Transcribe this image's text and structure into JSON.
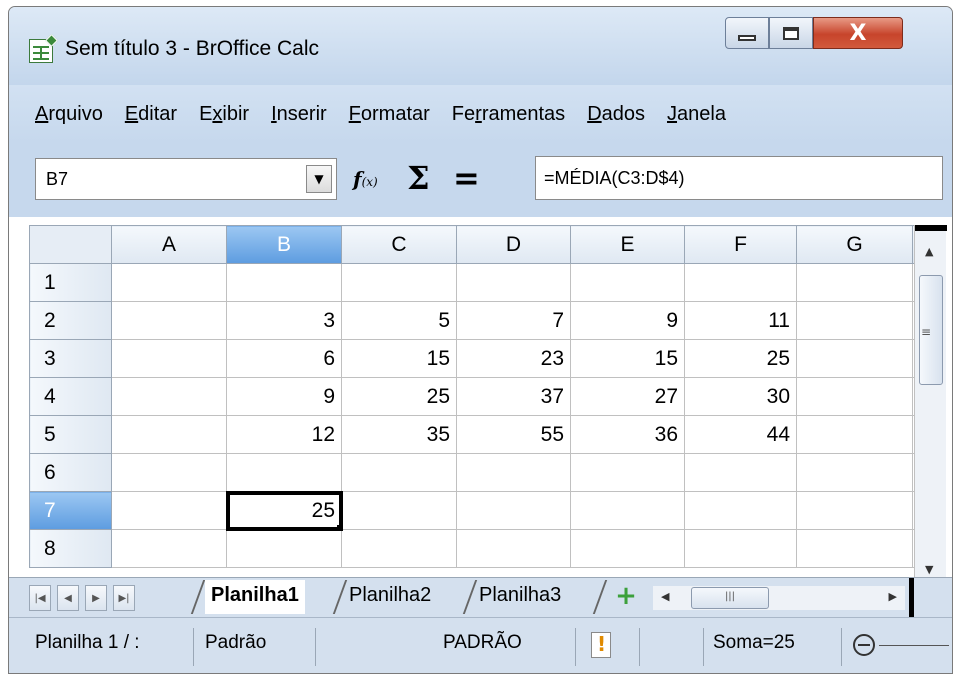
{
  "window": {
    "title": "Sem título 3 - BrOffice Calc",
    "close_glyph": "X"
  },
  "menu": [
    {
      "pre": "",
      "ul": "A",
      "post": "rquivo"
    },
    {
      "pre": "",
      "ul": "E",
      "post": "ditar"
    },
    {
      "pre": "E",
      "ul": "x",
      "post": "ibir"
    },
    {
      "pre": "",
      "ul": "I",
      "post": "nserir"
    },
    {
      "pre": "",
      "ul": "F",
      "post": "ormatar"
    },
    {
      "pre": "Fe",
      "ul": "r",
      "post": "ramentas"
    },
    {
      "pre": "",
      "ul": "D",
      "post": "ados"
    },
    {
      "pre": "",
      "ul": "J",
      "post": "anela"
    }
  ],
  "formula_bar": {
    "name_box": "B7",
    "fx_label": "f",
    "fx_sub": "(x)",
    "sum_symbol": "Σ",
    "equals_symbol": "=",
    "formula": "=MÉDIA(C3:D$4)"
  },
  "sheet": {
    "columns": [
      "A",
      "B",
      "C",
      "D",
      "E",
      "F",
      "G"
    ],
    "active_column": "B",
    "active_row": "7",
    "rows": [
      {
        "label": "1",
        "cells": [
          "",
          "",
          "",
          "",
          "",
          "",
          ""
        ]
      },
      {
        "label": "2",
        "cells": [
          "",
          "3",
          "5",
          "7",
          "9",
          "11",
          ""
        ]
      },
      {
        "label": "3",
        "cells": [
          "",
          "6",
          "15",
          "23",
          "15",
          "25",
          ""
        ]
      },
      {
        "label": "4",
        "cells": [
          "",
          "9",
          "25",
          "37",
          "27",
          "30",
          ""
        ]
      },
      {
        "label": "5",
        "cells": [
          "",
          "12",
          "35",
          "55",
          "36",
          "44",
          ""
        ]
      },
      {
        "label": "6",
        "cells": [
          "",
          "",
          "",
          "",
          "",
          "",
          ""
        ]
      },
      {
        "label": "7",
        "cells": [
          "",
          "25",
          "",
          "",
          "",
          "",
          ""
        ]
      },
      {
        "label": "8",
        "cells": [
          "",
          "",
          "",
          "",
          "",
          "",
          ""
        ]
      }
    ],
    "selected_cell": {
      "row": "7",
      "col": "B"
    }
  },
  "tabs": {
    "sheets": [
      "Planilha1",
      "Planilha2",
      "Planilha3"
    ],
    "active": "Planilha1",
    "add_symbol": "+"
  },
  "status": {
    "sheet_position": "Planilha 1 / :",
    "style": "Padrão",
    "mode": "PADRÃO",
    "sum": "Soma=25"
  }
}
